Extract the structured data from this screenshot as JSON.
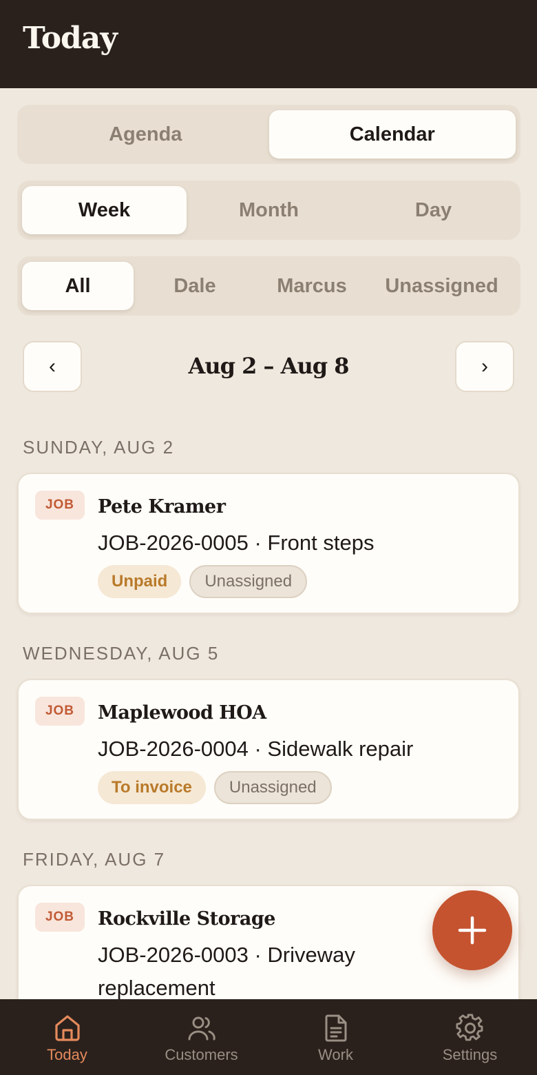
{
  "header": {
    "title": "Today"
  },
  "view_toggle": {
    "agenda": "Agenda",
    "calendar": "Calendar",
    "selected": "Calendar"
  },
  "range_toggle": {
    "week": "Week",
    "month": "Month",
    "day": "Day",
    "selected": "Week"
  },
  "assignee_filter": {
    "all": "All",
    "dale": "Dale",
    "marcus": "Marcus",
    "unassigned": "Unassigned",
    "selected": "All"
  },
  "date_nav": {
    "prev": "‹",
    "next": "›",
    "range": "Aug 2 – Aug 8"
  },
  "days": [
    {
      "label": "SUNDAY, AUG 2",
      "item": {
        "tag": "JOB",
        "customer": "Pete Kramer",
        "description": "JOB-2026-0005 · Front steps",
        "badges": [
          "Unpaid",
          "Unassigned"
        ]
      }
    },
    {
      "label": "WEDNESDAY, AUG 5",
      "item": {
        "tag": "JOB",
        "customer": "Maplewood HOA",
        "description": "JOB-2026-0004 · Sidewalk repair",
        "badges": [
          "To invoice",
          "Unassigned"
        ]
      }
    },
    {
      "label": "FRIDAY, AUG 7",
      "item": {
        "tag": "JOB",
        "customer": "Rockville Storage",
        "description": "JOB-2026-0003 · Driveway replacement",
        "badges": []
      }
    }
  ],
  "fab": {
    "icon": "plus-icon"
  },
  "tabbar": [
    {
      "label": "Today",
      "icon": "home-icon",
      "active": true
    },
    {
      "label": "Customers",
      "icon": "users-icon",
      "active": false
    },
    {
      "label": "Work",
      "icon": "document-icon",
      "active": false
    },
    {
      "label": "Settings",
      "icon": "gear-icon",
      "active": false
    }
  ],
  "colors": {
    "header_bg": "#2a211c",
    "accent": "#c5532f",
    "active_tab": "#e58a5c",
    "page_bg": "#efe8de"
  }
}
